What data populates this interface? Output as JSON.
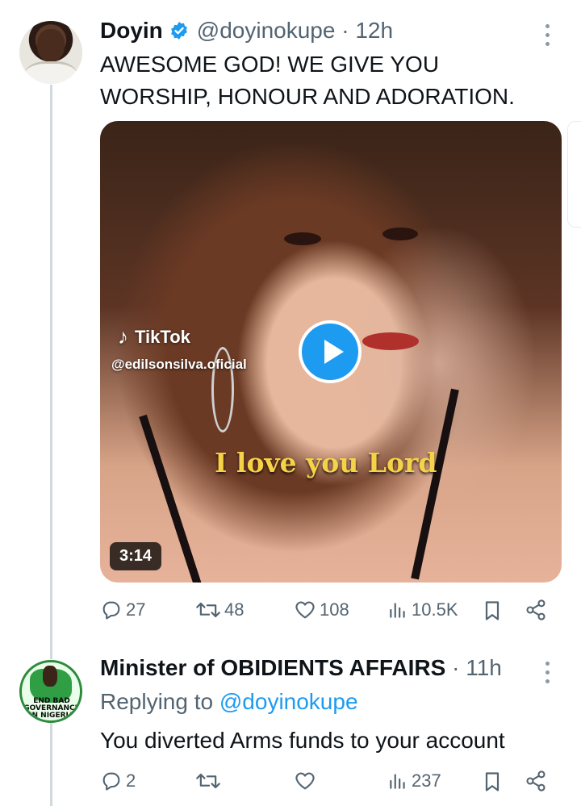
{
  "tweet": {
    "author_name": "Doyin",
    "author_handle": "@doyinokupe",
    "time": "12h",
    "text_line1": "AWESOME GOD! WE GIVE YOU",
    "text_line2": "WORSHIP, HONOUR AND ADORATION.",
    "media": {
      "platform_label": "TikTok",
      "source_handle": "@edilsonsilva.oficial",
      "caption": "I love you Lord",
      "duration": "3:14"
    },
    "stats": {
      "replies": "27",
      "retweets": "48",
      "likes": "108",
      "views": "10.5K"
    }
  },
  "reply": {
    "author_name": "Minister of OBIDIENTS AFFAIRS",
    "time": "11h",
    "replying_to_prefix": "Replying to",
    "replying_to_handle": "@doyinokupe",
    "text": "You diverted Arms funds to your account",
    "avatar_text": "END BAD GOVERNANCE IN NIGERIA",
    "stats": {
      "replies": "2",
      "retweets": "",
      "likes": "",
      "views": "237"
    }
  },
  "colors": {
    "accent": "#1d9bf0",
    "muted": "#536471",
    "thread_line": "#cfd9de",
    "caption": "#f5d247"
  },
  "icons": [
    "verified-badge-icon",
    "more-icon",
    "reply-icon",
    "retweet-icon",
    "like-icon",
    "views-icon",
    "bookmark-icon",
    "share-icon",
    "play-icon",
    "tiktok-logo-icon"
  ]
}
